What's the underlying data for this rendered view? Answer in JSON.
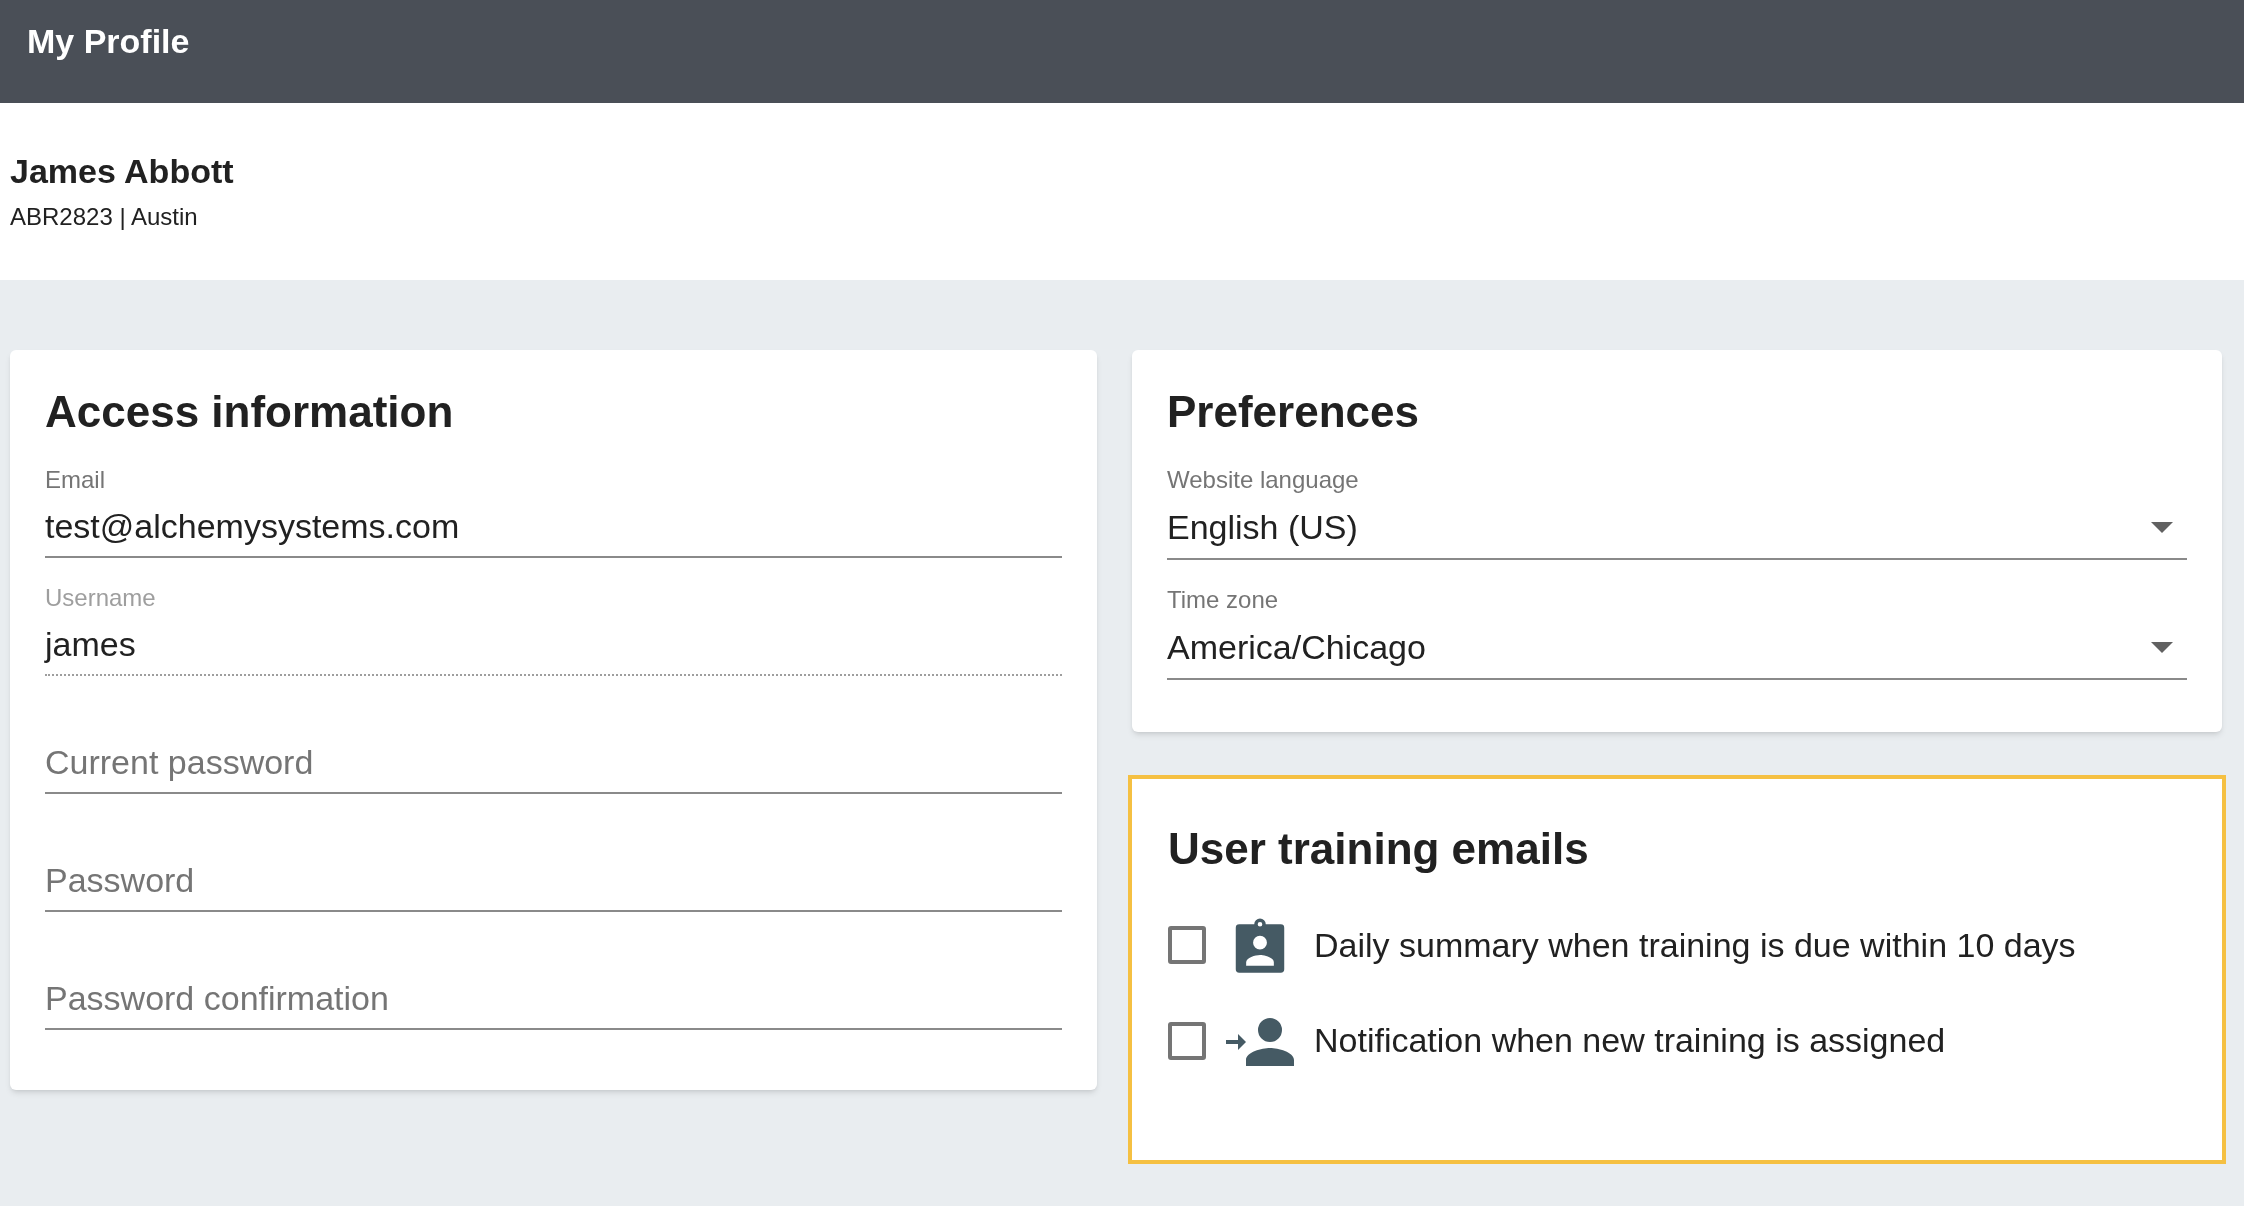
{
  "header": {
    "title": "My Profile"
  },
  "profile": {
    "name": "James Abbott",
    "details": "ABR2823 | Austin"
  },
  "access": {
    "title": "Access information",
    "fields": [
      {
        "label": "Email",
        "value": "test@alchemysystems.com",
        "disabled": false
      },
      {
        "label": "Username",
        "value": "james",
        "disabled": true
      },
      {
        "placeholder": "Current password",
        "disabled": false
      },
      {
        "placeholder": "Password",
        "disabled": false
      },
      {
        "placeholder": "Password confirmation",
        "disabled": false
      }
    ]
  },
  "preferences": {
    "title": "Preferences",
    "selects": [
      {
        "label": "Website language",
        "value": "English (US)"
      },
      {
        "label": "Time zone",
        "value": "America/Chicago"
      }
    ]
  },
  "training_emails": {
    "title": "User training emails",
    "options": [
      {
        "kind": "badge",
        "label": "Daily summary when training is due within 10 days",
        "checked": false
      },
      {
        "kind": "assign",
        "label": "Notification when new training is assigned",
        "checked": false
      }
    ]
  }
}
